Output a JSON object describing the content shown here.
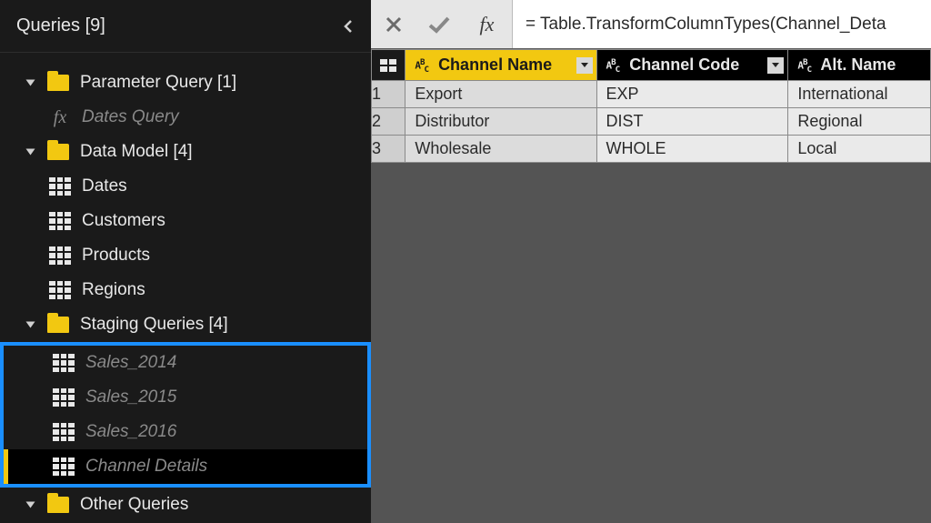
{
  "queries_pane": {
    "title": "Queries [9]",
    "groups": [
      {
        "label": "Parameter Query [1]",
        "icon": "folder",
        "expanded": true,
        "children": [
          {
            "label": "Dates Query",
            "icon": "fx",
            "faded": true
          }
        ]
      },
      {
        "label": "Data Model [4]",
        "icon": "folder",
        "expanded": true,
        "children": [
          {
            "label": "Dates",
            "icon": "table"
          },
          {
            "label": "Customers",
            "icon": "table"
          },
          {
            "label": "Products",
            "icon": "table"
          },
          {
            "label": "Regions",
            "icon": "table"
          }
        ]
      },
      {
        "label": "Staging Queries [4]",
        "icon": "folder",
        "expanded": true,
        "highlight_box": true,
        "children": [
          {
            "label": "Sales_2014",
            "icon": "table",
            "faded": true
          },
          {
            "label": "Sales_2015",
            "icon": "table",
            "faded": true
          },
          {
            "label": "Sales_2016",
            "icon": "table",
            "faded": true
          },
          {
            "label": "Channel Details",
            "icon": "table",
            "faded": true,
            "selected": true
          }
        ]
      },
      {
        "label": "Other Queries",
        "icon": "folder",
        "expanded": true,
        "children": []
      }
    ]
  },
  "formula_bar": {
    "fx_label": "fx",
    "formula": "= Table.TransformColumnTypes(Channel_Deta"
  },
  "table": {
    "columns": [
      {
        "name": "Channel Name",
        "type_icon": "ABC",
        "selected": true
      },
      {
        "name": "Channel Code",
        "type_icon": "ABC",
        "selected": false
      },
      {
        "name": "Alt. Name",
        "type_icon": "ABC",
        "selected": false
      }
    ],
    "rows": [
      {
        "n": "1",
        "cells": [
          "Export",
          "EXP",
          "International"
        ]
      },
      {
        "n": "2",
        "cells": [
          "Distributor",
          "DIST",
          "Regional"
        ]
      },
      {
        "n": "3",
        "cells": [
          "Wholesale",
          "WHOLE",
          "Local"
        ]
      }
    ]
  }
}
